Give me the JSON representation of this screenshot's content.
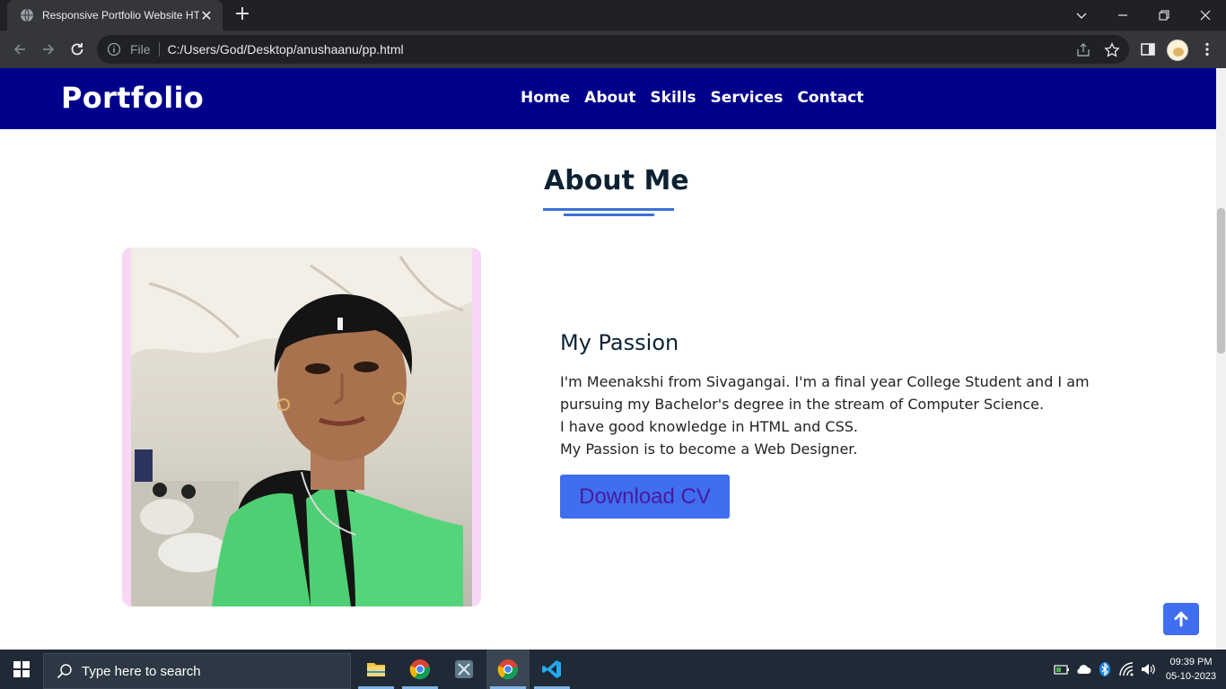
{
  "browser": {
    "tab_title": "Responsive Portfolio Website HT",
    "new_tab": "+",
    "close_tab": "✕",
    "file_label": "File",
    "url": "C:/Users/God/Desktop/anushaanu/pp.html"
  },
  "site": {
    "logo": "Portfolio",
    "nav": [
      "Home",
      "About",
      "Skills",
      "Services",
      "Contact"
    ]
  },
  "about": {
    "title": "About Me",
    "subtitle": "My Passion",
    "paragraphs": [
      "I'm Meenakshi from Sivagangai. I'm a final year College Student and I am pursuing my Bachelor's degree in the stream of Computer Science.",
      "I have good knowledge in HTML and CSS.",
      "My Passion is to become a Web Designer."
    ],
    "button_label": "Download CV"
  },
  "taskbar": {
    "search_placeholder": "Type here to search",
    "time": "09:39 PM",
    "date": "05-10-2023"
  },
  "colors": {
    "header_bg": "#00008b",
    "accent": "#3f6ef0",
    "title_text": "#0c2233"
  }
}
